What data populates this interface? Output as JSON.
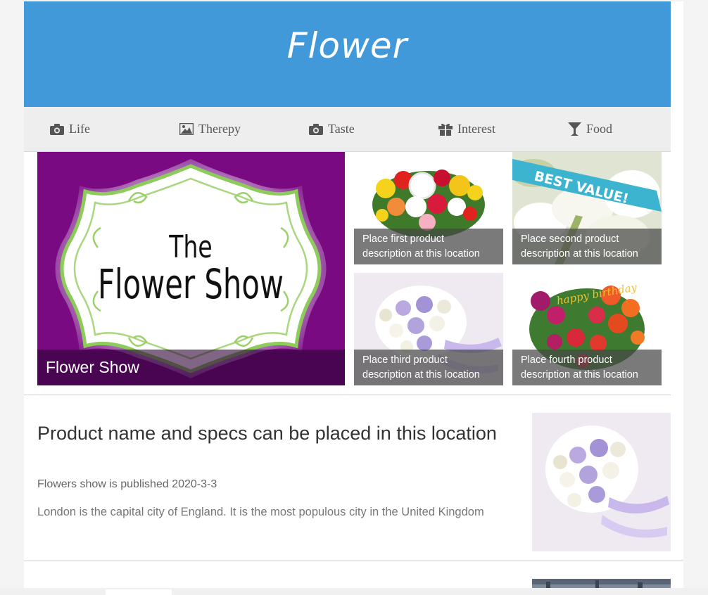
{
  "header": {
    "title": "Flower"
  },
  "nav": {
    "items": [
      {
        "label": "Life",
        "icon": "camera-icon"
      },
      {
        "label": "Therepy",
        "icon": "image-icon"
      },
      {
        "label": "Taste",
        "icon": "camera-icon"
      },
      {
        "label": "Interest",
        "icon": "gift-icon"
      },
      {
        "label": "Food",
        "icon": "cocktail-icon"
      }
    ]
  },
  "feature": {
    "image_text_line1": "The",
    "image_text_line2": "Flower Show",
    "caption": "Flower Show",
    "products": [
      {
        "caption": "Place first product description at this location"
      },
      {
        "caption": "Place second product description at this location",
        "banner": "BEST VALUE!"
      },
      {
        "caption": "Place third product description at this location"
      },
      {
        "caption": "Place fourth product description at this location",
        "card_text": "happy birthday"
      }
    ]
  },
  "article": {
    "title": "Product name and specs can be placed in this location",
    "meta": "Flowers show is published 2020-3-3",
    "excerpt": "London is the capital city of England. It is the most populous city in the United Kingdom"
  },
  "colors": {
    "header_bg": "#4299da",
    "nav_bg": "#eeeeee",
    "feature_bg": "#7a0a82",
    "frame_green": "#8dcb5a"
  }
}
